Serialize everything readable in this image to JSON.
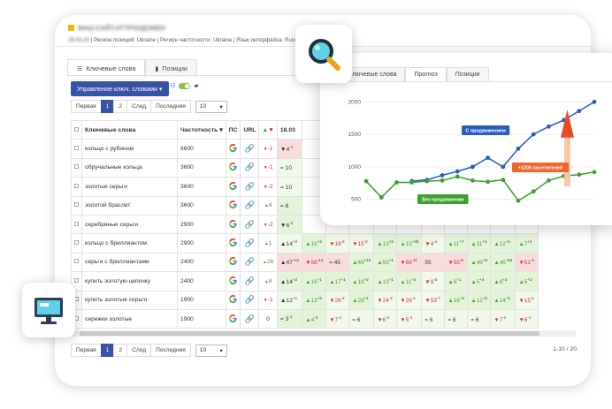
{
  "header": {
    "site": "ВАШ-САЙТ.НТТРS//ДОМЕН",
    "meta_blur": "28.03.20",
    "meta": "| Регион позиций: Ukraine | Регион частотности: Ukraine | Язык интерфейса: Russian"
  },
  "tabs": [
    {
      "label": "Ключевые слова"
    },
    {
      "label": "Позиции"
    }
  ],
  "manage_button": "Управление ключ. словами ▾",
  "pager": {
    "first": "Первая",
    "p1": "1",
    "p2": "2",
    "next": "След",
    "last": "Последняя",
    "per_page": "10"
  },
  "table": {
    "h_kw": "Ключевые слова",
    "h_freq": "Частотность",
    "h_ps": "ПС",
    "h_url": "URL",
    "h_date": "18.03"
  },
  "rows": [
    {
      "kw": "кольцо с рубином",
      "freq": "6600",
      "d": "-1",
      "d_dir": "down",
      "p1": "▼4",
      "p1_sup": "-1",
      "cls": "rd",
      "pos": []
    },
    {
      "kw": "обручальные кольца",
      "freq": "3600",
      "d": "-1",
      "d_dir": "down",
      "p1": "= 10",
      "p1_sup": "",
      "cls": "lg",
      "pos": []
    },
    {
      "kw": "золотые серьги",
      "freq": "3600",
      "d": "-2",
      "d_dir": "down",
      "p1": "= 10",
      "p1_sup": "",
      "cls": "lg",
      "pos": []
    },
    {
      "kw": "золотой браслет",
      "freq": "3600",
      "d": "4",
      "d_dir": "up",
      "p1": "= 6",
      "p1_sup": "",
      "cls": "gr",
      "pos": []
    },
    {
      "kw": "серебряные серьги",
      "freq": "2900",
      "d": "-2",
      "d_dir": "down",
      "p1": "▼6",
      "p1_sup": "-2",
      "cls": "gr",
      "pos": []
    },
    {
      "kw": "кольцо с бриллиантом",
      "freq": "2900",
      "d": "1",
      "d_dir": "up",
      "p1": "▲14",
      "p1_sup": "+2",
      "cls": "lg",
      "pos": [
        [
          "▲16",
          "+2",
          "u"
        ],
        [
          "▼18",
          "-2",
          "d"
        ],
        [
          "▼15",
          "-2",
          "d"
        ],
        [
          "▲13",
          "+2",
          "u"
        ],
        [
          "▲15",
          "+45",
          "u"
        ],
        [
          "▼4",
          "-1",
          "d"
        ],
        [
          "▲11",
          "+7",
          "u"
        ],
        [
          "▲11",
          "+1",
          "u"
        ],
        [
          "▲12",
          "+1",
          "u"
        ],
        [
          "▲7",
          "+1",
          "u"
        ]
      ]
    },
    {
      "kw": "серьги с бриллиантами",
      "freq": "2400",
      "d": "26",
      "d_dir": "up",
      "p1": "▲47",
      "p1_sup": "+11",
      "cls": "rd",
      "pos": [
        [
          "▼58",
          "-13",
          "d"
        ],
        [
          "= 45",
          "",
          "n"
        ],
        [
          "▲49",
          "+10",
          "u"
        ],
        [
          "▲55",
          "+1",
          "u"
        ],
        [
          "▼66",
          "-11",
          "d"
        ],
        [
          "55",
          "",
          "n"
        ],
        [
          "▼55",
          "-6",
          "d"
        ],
        [
          "▲49",
          "+6",
          "u"
        ],
        [
          "▲45",
          "+51",
          "u"
        ],
        [
          "▼51",
          "-2",
          "d"
        ]
      ]
    },
    {
      "kw": "купить золотую цепочку",
      "freq": "2400",
      "d": "8",
      "d_dir": "up",
      "p1": "▲14",
      "p1_sup": "+2",
      "cls": "gr",
      "pos": [
        [
          "▲16",
          "+1",
          "u"
        ],
        [
          "▲17",
          "+1",
          "u"
        ],
        [
          "▲18",
          "+2",
          "u"
        ],
        [
          "▲13",
          "+1",
          "u"
        ],
        [
          "▲11",
          "+2",
          "u"
        ],
        [
          "▼9",
          "-3",
          "d"
        ],
        [
          "▲6",
          "+1",
          "u"
        ],
        [
          "▲5",
          "+4",
          "u"
        ],
        [
          "▲8",
          "+2",
          "u"
        ],
        [
          "▲5",
          "+3",
          "u"
        ]
      ]
    },
    {
      "kw": "купить золотые серьги",
      "freq": "1900",
      "d": "-1",
      "d_dir": "down",
      "p1": "▲12",
      "p1_sup": "+1",
      "cls": "lg",
      "pos": [
        [
          "▲13",
          "+3",
          "u"
        ],
        [
          "▼26",
          "-2",
          "d"
        ],
        [
          "▲28",
          "+1",
          "u"
        ],
        [
          "▼24",
          "-2",
          "d"
        ],
        [
          "▼26",
          "-1",
          "d"
        ],
        [
          "▼53",
          "-7",
          "d"
        ],
        [
          "▲16",
          "+4",
          "u"
        ],
        [
          "▲12",
          "+2",
          "u"
        ],
        [
          "▲14",
          "+1",
          "u"
        ],
        [
          "▼15",
          "-1",
          "d"
        ]
      ]
    },
    {
      "kw": "сережки золотые",
      "freq": "1900",
      "d": "0",
      "d_dir": "none",
      "p1": "= 3",
      "p1_sup": "-1",
      "cls": "gr",
      "pos": [
        [
          "▲4",
          "-3",
          "u"
        ],
        [
          "▼7",
          "-1",
          "d"
        ],
        [
          "= 6",
          "",
          "n"
        ],
        [
          "▼6",
          "-1",
          "d"
        ],
        [
          "▼5",
          "-1",
          "d"
        ],
        [
          "= 6",
          "",
          "n"
        ],
        [
          "= 6",
          "",
          "n"
        ],
        [
          "= 6",
          "",
          "n"
        ],
        [
          "▼7",
          "-1",
          "d"
        ],
        [
          "▼6",
          "-1",
          "d"
        ]
      ]
    }
  ],
  "footer_count": "1-10 / 20",
  "chart_tabs": [
    {
      "label": "Ключевые слова"
    },
    {
      "label": "Прогноз"
    },
    {
      "label": "Позиции"
    }
  ],
  "chart_data": {
    "type": "line",
    "ylim": [
      400,
      2100
    ],
    "yticks": [
      "2000",
      "1500",
      "1000",
      "500"
    ],
    "series": [
      {
        "name": "С продвижением",
        "color": "#2a5bbf",
        "values": [
          null,
          null,
          null,
          780,
          800,
          870,
          930,
          1000,
          1140,
          1000,
          1280,
          1500,
          1620,
          1720,
          1860,
          2000
        ]
      },
      {
        "name": "Без продвижения",
        "color": "#3aa22a",
        "values": [
          780,
          530,
          760,
          760,
          780,
          790,
          850,
          790,
          770,
          800,
          480,
          620,
          790,
          860,
          880,
          920
        ]
      }
    ],
    "annotations": [
      "С продвижением",
      "Без продвижения",
      "+1200 посетителей"
    ]
  },
  "icons": {
    "search": "magnifier-icon",
    "monitor": "monitor-icon"
  },
  "colors": {
    "accent": "#3753a6",
    "green": "#3aa22a",
    "blue": "#2a5bbf",
    "orange": "#f0662a"
  }
}
